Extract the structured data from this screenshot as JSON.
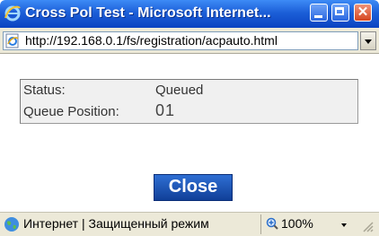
{
  "window": {
    "title": "Cross Pol Test - Microsoft Internet...",
    "icon": "ie-icon"
  },
  "address": {
    "url": "http://192.168.0.1/fs/registration/acpauto.html"
  },
  "status_panel": {
    "status_label": "Status:",
    "status_value": "Queued",
    "queue_label": "Queue Position:",
    "queue_value": "01"
  },
  "actions": {
    "close_label": "Close"
  },
  "statusbar": {
    "zone_text": "Интернет | Защищенный режим",
    "zoom_text": "100%"
  },
  "colors": {
    "titlebar": "#0b43c1",
    "close_button": "#1a4fb0"
  }
}
